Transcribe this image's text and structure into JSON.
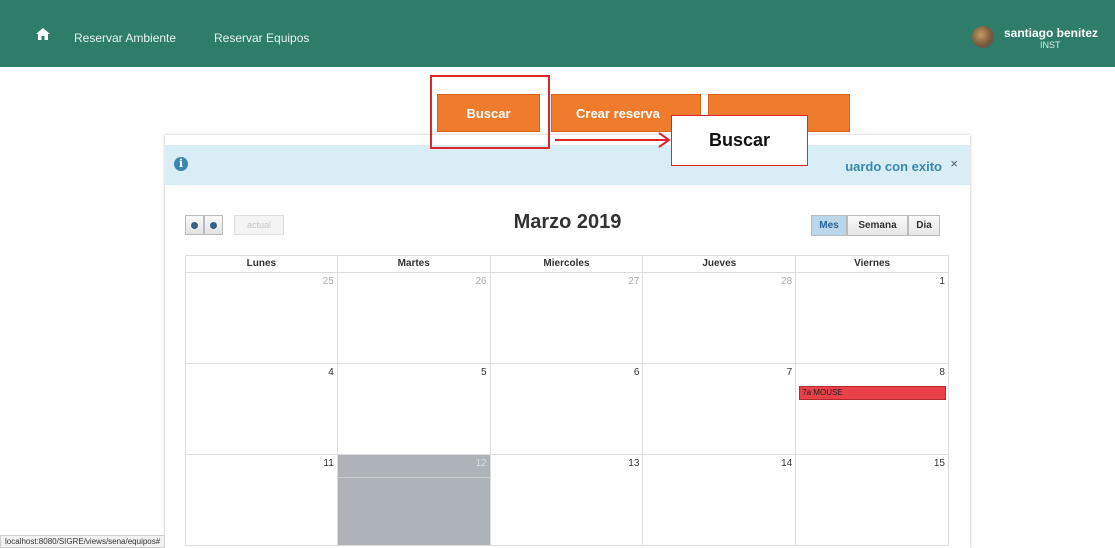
{
  "nav": {
    "home_icon": "home-icon",
    "links": [
      "Reservar Ambiente",
      "Reservar Equipos"
    ],
    "user_name": "santiago benitez",
    "user_role": "INST"
  },
  "actions": {
    "buscar": "Buscar",
    "crear": "Crear reserva",
    "third": ""
  },
  "annotation": {
    "callout": "Buscar"
  },
  "alert": {
    "icon": "info-icon",
    "message": "uardo con exito",
    "close": "×"
  },
  "calendar": {
    "title": "Marzo 2019",
    "today_label": "actual",
    "views": [
      "Mes",
      "Semana",
      "Dia"
    ],
    "active_view": "Mes",
    "headers": [
      "Lunes",
      "Martes",
      "Miercoles",
      "Jueves",
      "Viernes"
    ],
    "weeks": [
      [
        "25",
        "26",
        "27",
        "28",
        "1"
      ],
      [
        "4",
        "5",
        "6",
        "7",
        "8"
      ],
      [
        "11",
        "12",
        "13",
        "14",
        "15"
      ]
    ],
    "event": "7a MOUSE"
  },
  "status_url": "localhost:8080/SIGRE/views/sena/equipos#",
  "colors": {
    "navbar": "#2e7d6b",
    "button": "#ef7b2c",
    "annotation": "#e0242d",
    "event": "#e8414a",
    "alert_bg": "#d9edf7"
  }
}
